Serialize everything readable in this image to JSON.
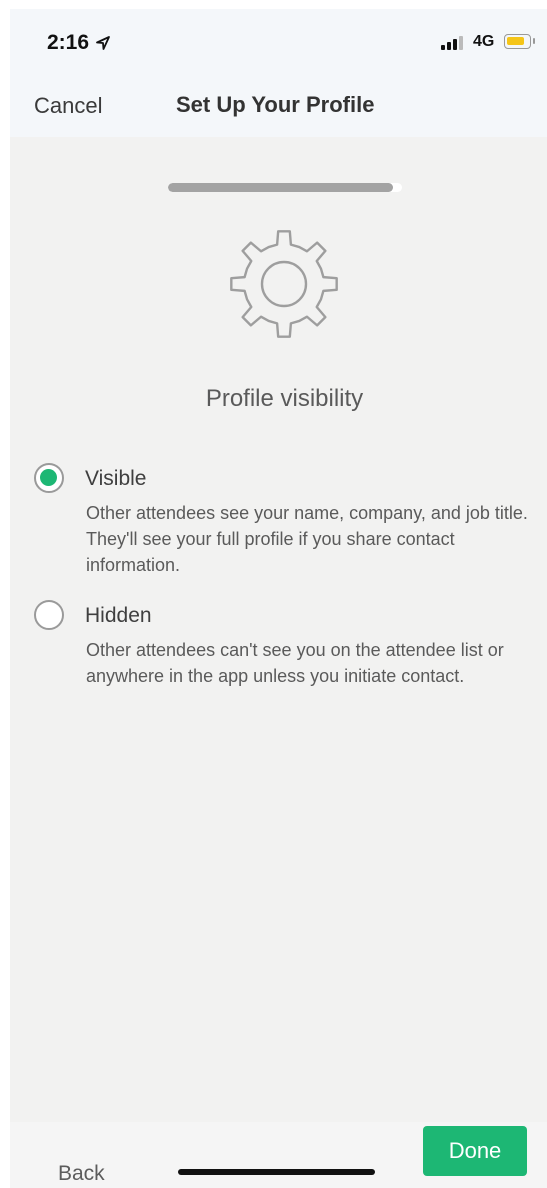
{
  "status_bar": {
    "time": "2:16",
    "network": "4G",
    "icons": [
      "location-arrow-icon",
      "signal-icon",
      "battery-icon"
    ],
    "battery_color": "#f5c518"
  },
  "nav": {
    "cancel_label": "Cancel",
    "title": "Set Up Your Profile"
  },
  "progress": {
    "fraction": 0.96
  },
  "header": {
    "icon": "gear-icon",
    "title": "Profile visibility"
  },
  "options": [
    {
      "label": "Visible",
      "description": "Other attendees see your name, company, and job title. They'll see your full profile if you share contact information.",
      "selected": true
    },
    {
      "label": "Hidden",
      "description": "Other attendees can't see you on the attendee list or anywhere in the app unless you initiate contact.",
      "selected": false
    }
  ],
  "footer": {
    "back_label": "Back",
    "done_label": "Done"
  },
  "colors": {
    "accent": "#1db774",
    "background": "#f2f2f1"
  }
}
